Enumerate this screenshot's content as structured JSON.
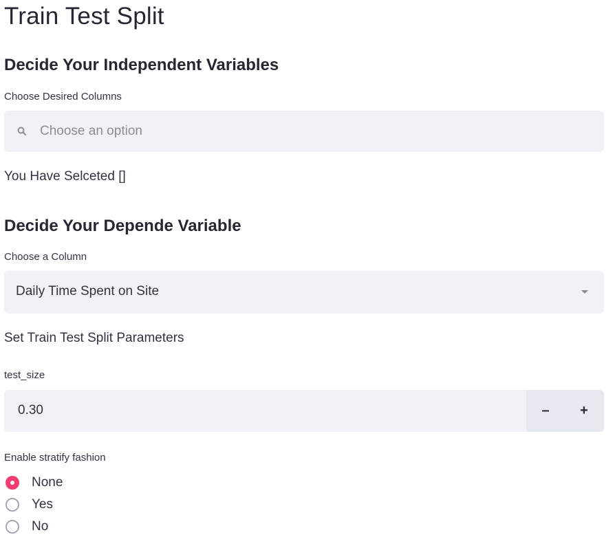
{
  "page_title": "Train Test Split",
  "independent": {
    "heading": "Decide Your Independent Variables",
    "multiselect_label": "Choose Desired Columns",
    "multiselect_placeholder": "Choose an option",
    "selected_text": "You Have Selceted []"
  },
  "dependent": {
    "heading": "Decide Your Depende Variable",
    "select_label": "Choose a Column",
    "select_value": "Daily Time Spent on Site"
  },
  "split_params": {
    "heading": "Set Train Test Split Parameters",
    "test_size_label": "test_size",
    "test_size_value": "0.30",
    "decrement_label": "–",
    "increment_label": "+"
  },
  "stratify": {
    "label": "Enable stratify fashion",
    "options": [
      "None",
      "Yes",
      "No"
    ],
    "selected": "None"
  },
  "colors": {
    "accent": "#f03c6f",
    "input_bg": "#f0f2f6",
    "stepper_bg": "#e6e9ef",
    "text": "#31333f",
    "placeholder": "#8a8d96"
  },
  "icons": {
    "search": "search-icon",
    "dropdown": "chevron-down-icon"
  }
}
